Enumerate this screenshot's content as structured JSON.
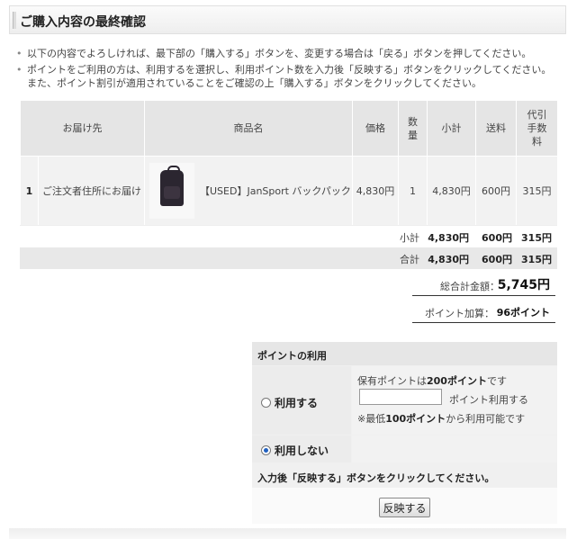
{
  "page": {
    "title": "ご購入内容の最終確認"
  },
  "notes": [
    "以下の内容でよろしければ、最下部の「購入する」ボタンを、変更する場合は「戻る」ボタンを押してください。",
    "ポイントをご利用の方は、利用するを選択し、利用ポイント数を入力後「反映する」ボタンをクリックしてください。",
    "また、ポイント割引が適用されていることをご確認の上「購入する」ボタンをクリックしてください。"
  ],
  "table": {
    "headers": {
      "destination": "お届け先",
      "product": "商品名",
      "price": "価格",
      "qty_line1": "数",
      "qty_line2": "量",
      "subtotal": "小計",
      "shipping": "送料",
      "fee_line1": "代引",
      "fee_line2": "手数",
      "fee_line3": "料"
    },
    "row": {
      "index": "1",
      "destination": "ご注文者住所にお届け",
      "product_name": "【USED】JanSport バックパック",
      "price": "4,830円",
      "qty": "1",
      "subtotal": "4,830円",
      "shipping": "600円",
      "fee": "315円"
    }
  },
  "subtotal_row": {
    "label": "小計",
    "subtotal": "4,830円",
    "shipping": "600円",
    "fee": "315円"
  },
  "total_row": {
    "label": "合計",
    "subtotal": "4,830円",
    "shipping": "600円",
    "fee": "315円"
  },
  "grand_total": {
    "label": "総合計金額：",
    "value": "5,745円"
  },
  "points_added": {
    "label": "ポイント加算：",
    "value": "96ポイント"
  },
  "points": {
    "heading": "ポイントの利用",
    "use_label": "利用する",
    "no_use_label": "利用しない",
    "selected": "no_use",
    "held_prefix": "保有ポイントは",
    "held_value": "200ポイント",
    "held_suffix": "です",
    "input_value": "",
    "input_unit": "ポイント利用する",
    "min_prefix": "※最低",
    "min_value": "100ポイント",
    "min_suffix": "から利用可能です",
    "instruction": "入力後「反映する」ボタンをクリックしてください。",
    "apply_label": "反映する"
  },
  "icons": {
    "radio": "radio-button-icon",
    "product": "backpack-image"
  }
}
